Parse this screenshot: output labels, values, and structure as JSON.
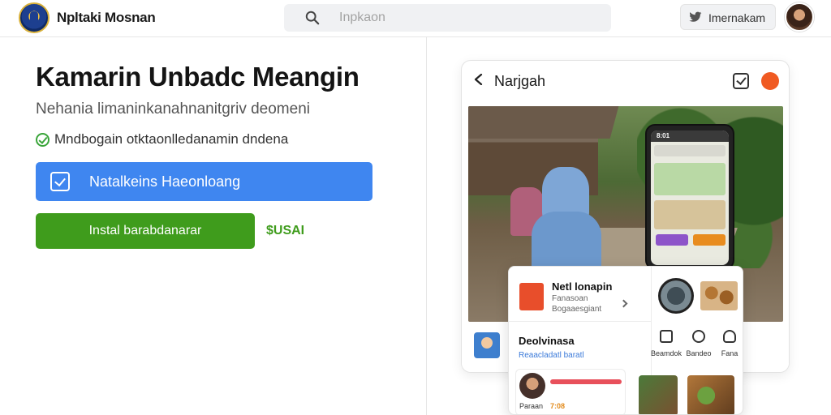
{
  "header": {
    "app_title": "Npltaki Mosnan",
    "search_placeholder": "Inpkaon",
    "share_label": "Imernakam"
  },
  "hero": {
    "title": "Kamarin Unbadc Meangin",
    "subtitle": "Nehania limaninkanahnanitgriv deomeni",
    "check_text": "Mndbogain otktaonlledanamin dndena",
    "primary_button": "Natalkeins Haeonloang",
    "install_button": "Instal barabdanarar",
    "price": "$USAI"
  },
  "preview": {
    "title": "Narjgah",
    "phone_time": "8:01",
    "tabs": [
      {
        "label": "Beamdok"
      },
      {
        "label": "Bandeo"
      },
      {
        "label": "Fana"
      }
    ],
    "card": {
      "item1_name": "Netl lonapin",
      "item1_sub1": "Fanasoan",
      "item1_sub2": "Bogaaesgiant",
      "item2_name": "Deolvinasa",
      "item2_link": "Reaacladatl baratl",
      "item3_label": "Paraan",
      "item3_value": "7:08",
      "right_tab1": "Beamdok",
      "right_tab2": "Bandeo",
      "right_tab3": "Fana"
    }
  },
  "colors": {
    "primary_blue": "#3f86f0",
    "install_green": "#3f9c1c",
    "accent_orange": "#f05a22"
  },
  "icons": [
    "logo",
    "search-icon",
    "twitter-icon",
    "check-circle-icon",
    "checkbox-icon",
    "back-icon",
    "chevron-right-icon"
  ]
}
